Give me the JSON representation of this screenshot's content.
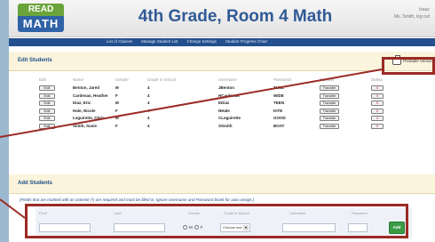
{
  "header": {
    "logo_top": "READ",
    "logo_bottom": "MATH",
    "title": "4th Grade, Room 4 Math",
    "user_line1": "Isaac",
    "user_line2": "Ms. Smith, log out"
  },
  "nav": {
    "links": [
      "List of Classes",
      "Manage Student List",
      "Change Settings",
      "Student Progress Chart"
    ]
  },
  "edit_students": {
    "title": "Edit Students",
    "print_label": "Printable Version",
    "columns": [
      "Edit",
      "Name",
      "Gender",
      "Grade in School",
      "Username",
      "Password",
      "Transfer",
      "Delete"
    ],
    "rows": [
      {
        "edit": "Edit",
        "name": "Benton, Jared",
        "gender": "M",
        "grade": "4",
        "username": "JBenton",
        "password": "TUNE",
        "transfer": "Transfer",
        "delete": "X"
      },
      {
        "edit": "Edit",
        "name": "Cardenas, Heather",
        "gender": "F",
        "grade": "4",
        "username": "HCardenas",
        "password": "WIDE",
        "transfer": "Transfer",
        "delete": "X"
      },
      {
        "edit": "Edit",
        "name": "Diaz, Eric",
        "gender": "M",
        "grade": "4",
        "username": "EDiaz",
        "password": "TEEN",
        "transfer": "Transfer",
        "delete": "X"
      },
      {
        "edit": "Edit",
        "name": "Hale, Nicole",
        "gender": "F",
        "grade": "4",
        "username": "NHale",
        "password": "KITE",
        "transfer": "Transfer",
        "delete": "X"
      },
      {
        "edit": "Edit",
        "name": "Leguirette, Chris",
        "gender": "M",
        "grade": "4",
        "username": "CLeguirette",
        "password": "GOOD",
        "transfer": "Transfer",
        "delete": "X"
      },
      {
        "edit": "Edit",
        "name": "Smith, Susie",
        "gender": "F",
        "grade": "4",
        "username": "SSmith",
        "password": "BOAT",
        "transfer": "Transfer",
        "delete": "X"
      }
    ]
  },
  "add_students": {
    "title": "Add Students",
    "note": "(Fields that are marked with an asterisk (*) are required and must be filled in. Ignore Username and Password blank for auto-assign.)",
    "labels": {
      "first": "First*",
      "last": "Last*",
      "gender": "Gender",
      "grade": "Grade in School",
      "username": "Username",
      "password": "Password"
    },
    "gender_options": [
      "M",
      "F"
    ],
    "grade_select_value": "Choose one",
    "add_button": "Add"
  },
  "colors": {
    "title_blue": "#315a96",
    "nav_blue": "#234f8e",
    "callout_red": "#9b2a25",
    "add_green": "#3a9b45"
  }
}
